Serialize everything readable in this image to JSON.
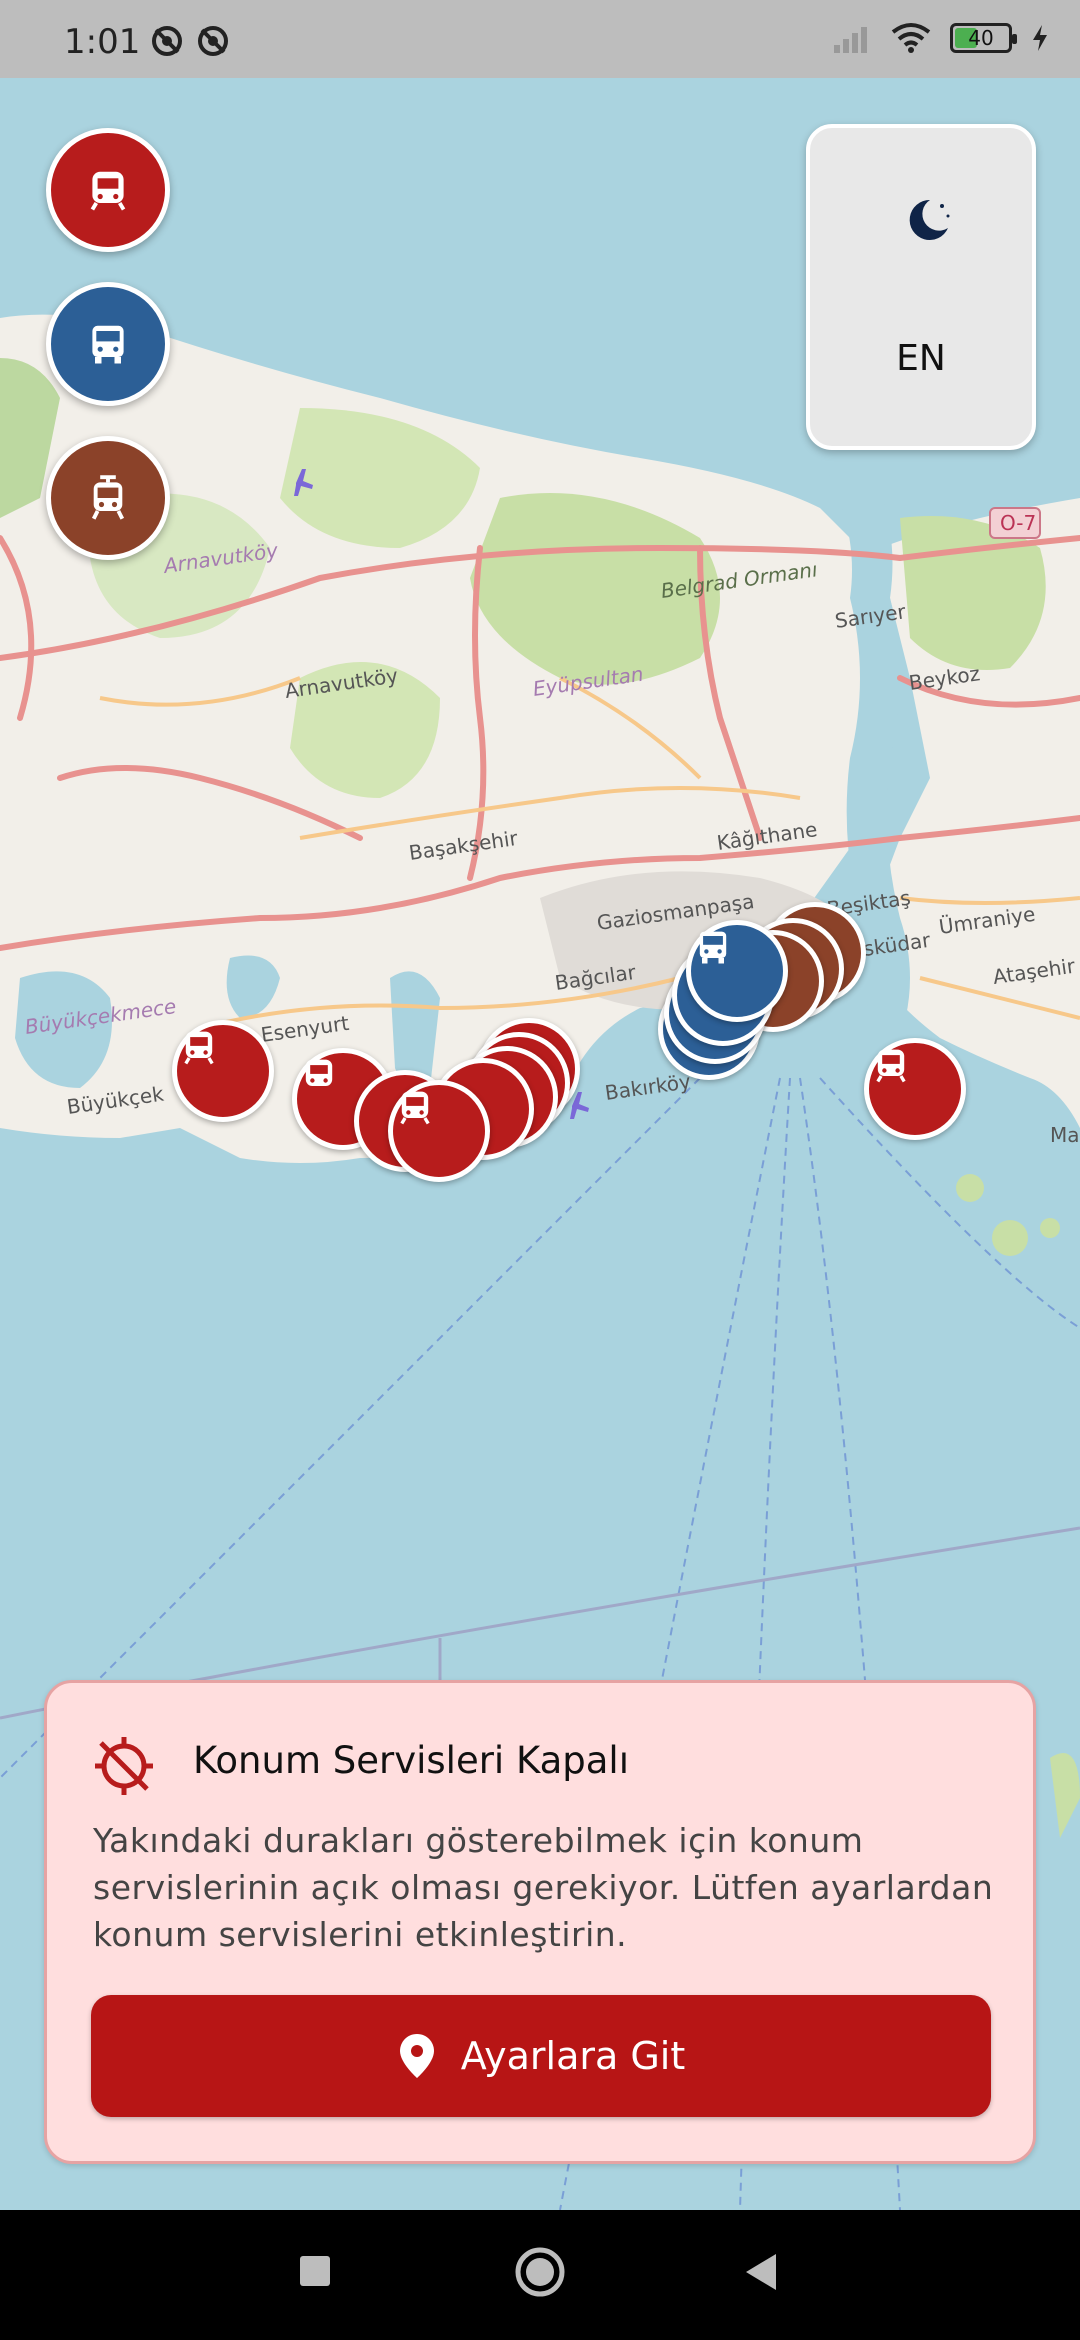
{
  "status_bar": {
    "time": "1:01",
    "battery": "40",
    "icons": [
      "location-off-icon",
      "location-off-icon",
      "signal-icon",
      "wifi-icon",
      "battery-icon",
      "charging-icon"
    ]
  },
  "theme_toggle": {
    "icon": "moon-icon",
    "language": "EN"
  },
  "transit_filters": [
    {
      "name": "metro-icon",
      "color": "#b71c1c"
    },
    {
      "name": "bus-icon",
      "color": "#2c5f96"
    },
    {
      "name": "tram-icon",
      "color": "#8b4229"
    }
  ],
  "map": {
    "labels": [
      "Arnavutköy",
      "Arnavutköy",
      "Belgrad Ormanı",
      "Sarıyer",
      "Eyüpsultan",
      "Beykoz",
      "Kâğıthane",
      "Başakşehir",
      "Gaziosmanpaşa",
      "Beşiktaş",
      "Üsküdar",
      "Ümraniye",
      "Ataşehir",
      "Bağcılar",
      "Esenyurt",
      "Büyükçekmece",
      "Büyükçek",
      "Bakırköy",
      "O-7",
      "Ma"
    ],
    "colors": {
      "water": "#aad3df",
      "land": "#f2efe9",
      "green": "#c8dfa6",
      "road": "#e8928f"
    }
  },
  "alert": {
    "icon": "location-disabled-icon",
    "title": "Konum Servisleri Kapalı",
    "message": "Yakındaki durakları gösterebilmek için konum servislerinin açık olması gerekiyor. Lütfen ayarlardan konum servislerini etkinleştirin.",
    "button_icon": "location-pin-icon",
    "button_label": "Ayarlara Git"
  },
  "nav_bar": {
    "buttons": [
      "recents-button",
      "home-button",
      "back-button"
    ]
  }
}
